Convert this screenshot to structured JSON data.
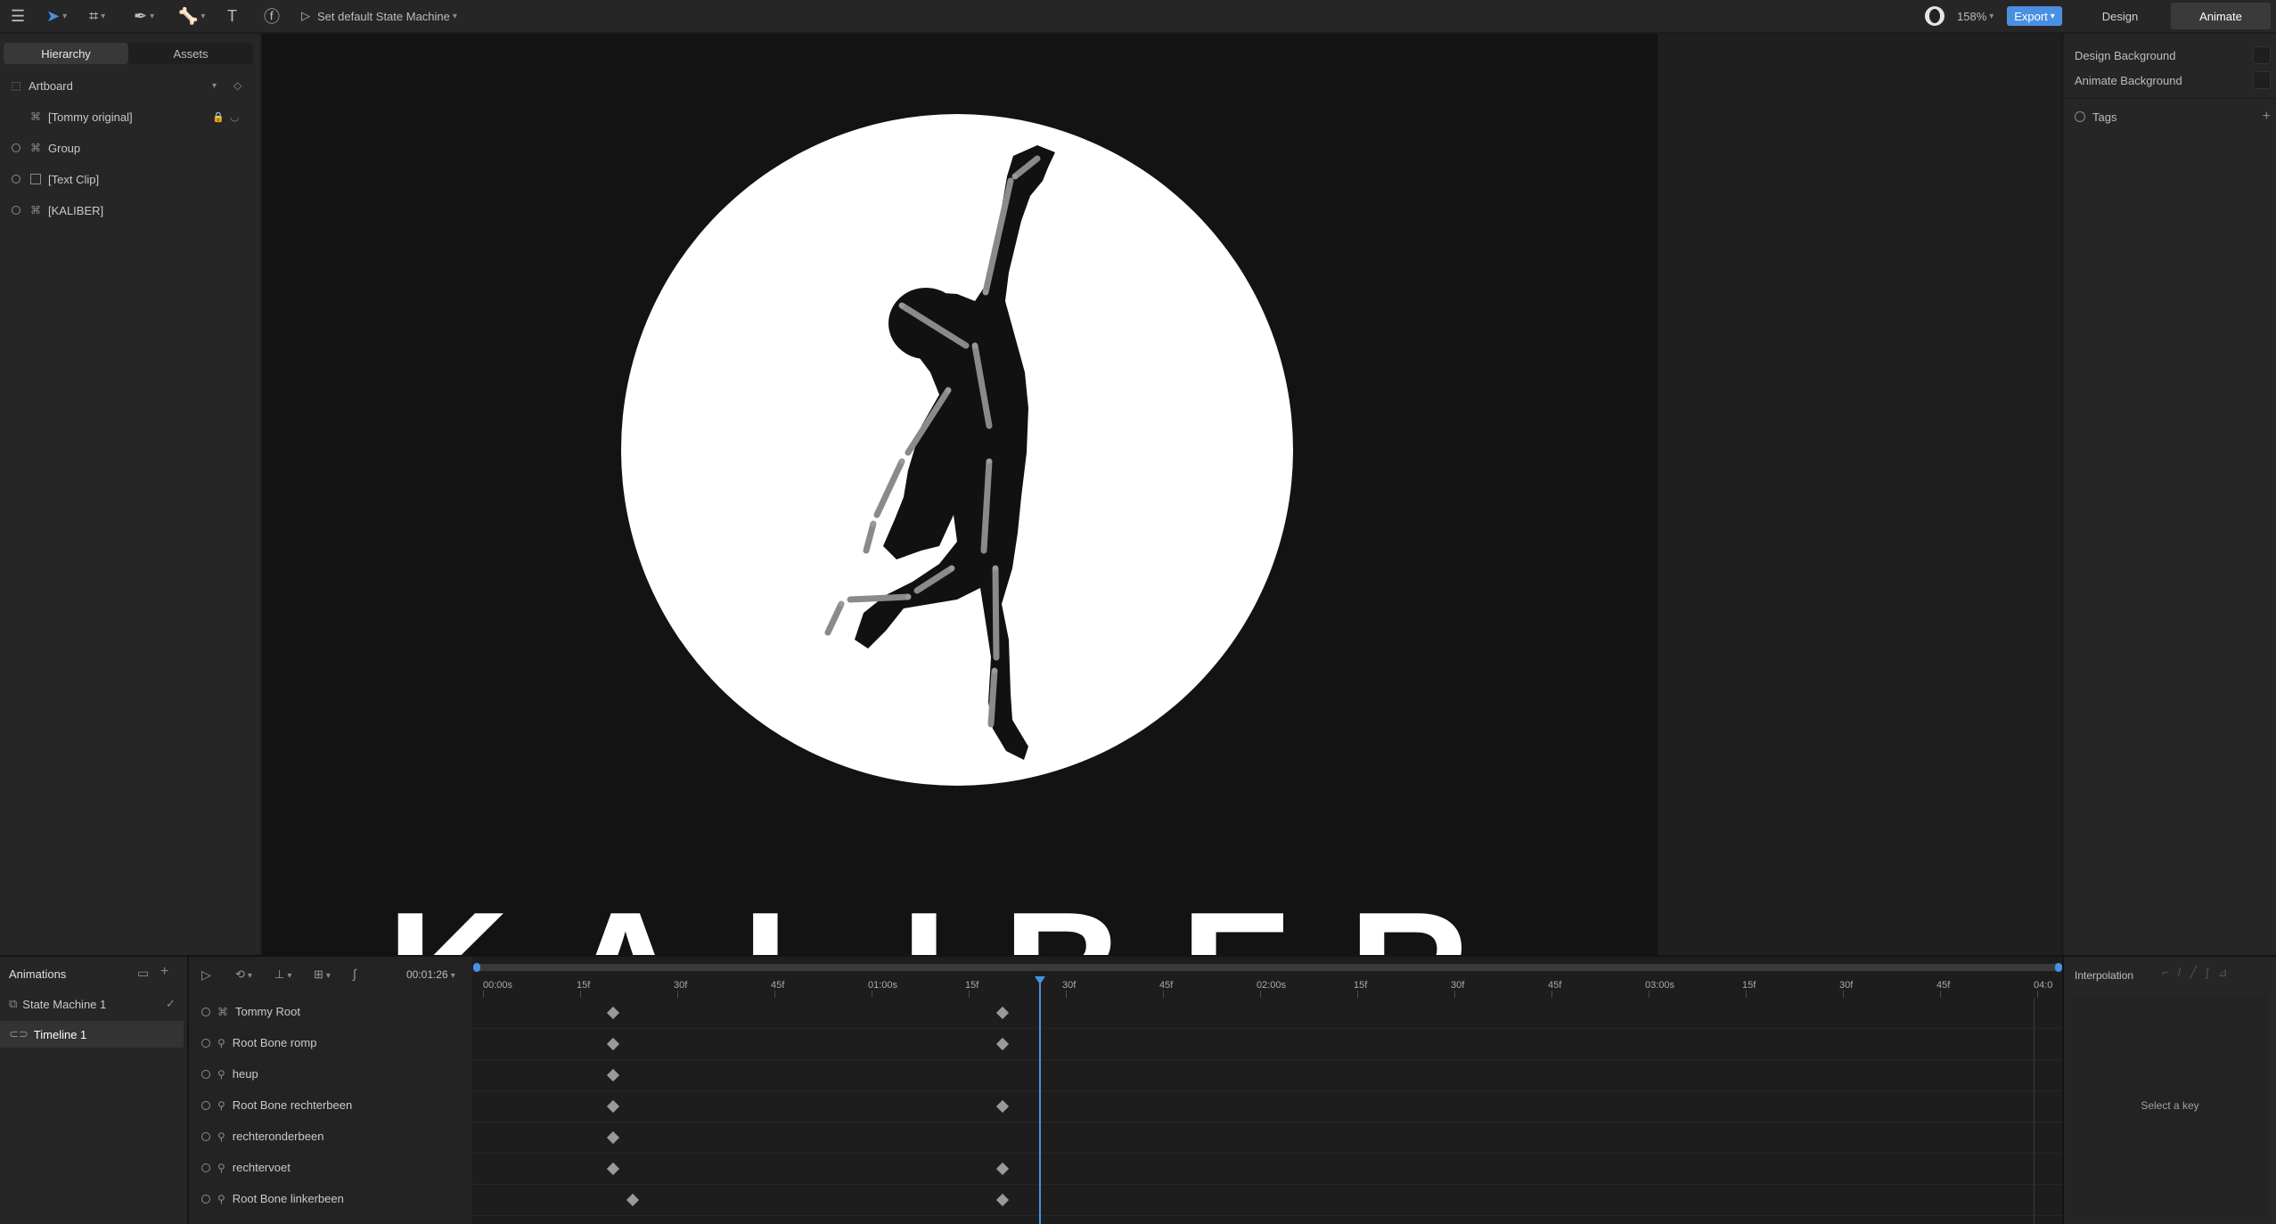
{
  "toolbar": {
    "state_machine_label": "Set default State Machine",
    "zoom": "158%",
    "export_label": "Export",
    "mode_tabs": [
      "Design",
      "Animate"
    ],
    "active_mode": "Animate"
  },
  "hierarchy": {
    "tabs": [
      "Hierarchy",
      "Assets"
    ],
    "active_tab": "Hierarchy",
    "artboard": "Artboard",
    "items": [
      {
        "label": "[Tommy original]",
        "icon": "node-icon"
      },
      {
        "label": "Group",
        "icon": "node-icon"
      },
      {
        "label": "[Text Clip]",
        "icon": "clip-icon"
      },
      {
        "label": "[KALIBER]",
        "icon": "node-icon"
      }
    ]
  },
  "inspector": {
    "design_background": "Design Background",
    "animate_background": "Animate Background",
    "tags": "Tags"
  },
  "canvas": {
    "logo_text": "KALIBER",
    "colors": {
      "artboard": "#131313",
      "circle": "#ffffff",
      "figure": "#111111",
      "bones": "#8a8a8a"
    }
  },
  "animations": {
    "title": "Animations",
    "items": [
      {
        "label": "State Machine 1",
        "icon": "state-machine-icon"
      },
      {
        "label": "Timeline 1",
        "icon": "timeline-icon"
      }
    ],
    "active": "Timeline 1"
  },
  "timeline": {
    "current_time": "00:01:26",
    "ruler": [
      "00:00s",
      "15f",
      "30f",
      "45f",
      "01:00s",
      "15f",
      "30f",
      "45f",
      "02:00s",
      "15f",
      "30f",
      "45f",
      "03:00s",
      "15f",
      "30f",
      "45f",
      "04:0"
    ],
    "layers": [
      {
        "label": "Tommy Root",
        "keys": [
          "15f",
          "01:15f"
        ]
      },
      {
        "label": "Root Bone romp",
        "keys": [
          "15f",
          "01:15f"
        ]
      },
      {
        "label": "heup",
        "keys": [
          "15f"
        ]
      },
      {
        "label": "Root Bone rechterbeen",
        "keys": [
          "15f",
          "01:15f"
        ]
      },
      {
        "label": "rechteronderbeen",
        "keys": [
          "15f"
        ]
      },
      {
        "label": "rechtervoet",
        "keys": [
          "15f",
          "01:15f"
        ]
      },
      {
        "label": "Root Bone linkerbeen",
        "keys": [
          "18f",
          "01:15f"
        ]
      }
    ]
  },
  "interpolation": {
    "title": "Interpolation",
    "empty_text": "Select a key"
  },
  "colors": {
    "accent": "#4a90e2",
    "playhead": "#4a90e2"
  }
}
